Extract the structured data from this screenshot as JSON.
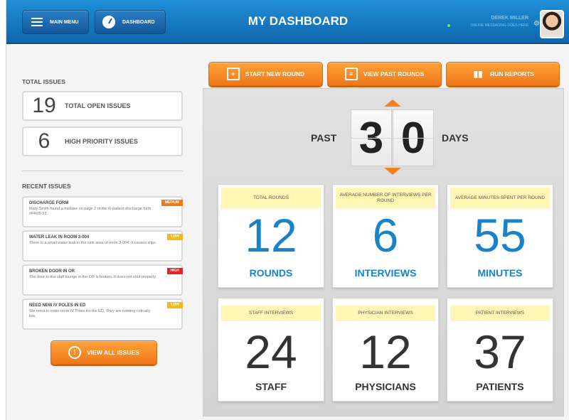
{
  "header": {
    "main_menu_label": "MAIN MENU",
    "dashboard_label": "DASHBOARD",
    "title": "MY DASHBOARD",
    "user_name": "DEREK MILLER",
    "user_status": "ONLINE   MESSAGING GOES HERE"
  },
  "sidebar": {
    "total_issues_heading": "TOTAL ISSUES",
    "open_issues": {
      "count": "19",
      "label": "TOTAL OPEN ISSUES"
    },
    "high_priority": {
      "count": "6",
      "label": "HIGH PRIORITY ISSUES"
    },
    "recent_heading": "RECENT ISSUES",
    "recent_issues": [
      {
        "title": "DISCHARGE FORM",
        "desc": "Mary Smith found a mistake on page 2 of the in-patient discharge form #FR05-22.",
        "priority": "MEDIUM",
        "color": "#f07a1a"
      },
      {
        "title": "WATER LEAK IN ROOM 3-004",
        "desc": "There is a small water leak in the sink area of room 3-004. It causes slips.",
        "priority": "LOW",
        "color": "#f5b81a"
      },
      {
        "title": "BROKEN DOOR IN OR",
        "desc": "The door to the staff lounge in the OR is broken. It does not shut properly.",
        "priority": "HIGH",
        "color": "#e52424"
      },
      {
        "title": "NEED NEW IV POLES IN ED",
        "desc": "We need to order more IV Poles for the ED. They are running critically low.",
        "priority": "LOW",
        "color": "#f5b81a"
      }
    ],
    "view_all_label": "VIEW ALL ISSUES"
  },
  "actions": {
    "start_new_round": "START NEW ROUND",
    "view_past_rounds": "VIEW PAST ROUNDS",
    "run_reports": "RUN REPORTS"
  },
  "period": {
    "prefix": "PAST",
    "digit1": "3",
    "digit2": "0",
    "suffix": "DAYS"
  },
  "stats_row1": [
    {
      "tag": "TOTAL ROUNDS",
      "value": "12",
      "unit": "ROUNDS"
    },
    {
      "tag": "AVERAGE NUMBER OF INTERVIEWS PER ROUND",
      "value": "6",
      "unit": "INTERVIEWS"
    },
    {
      "tag": "AVERAGE MINUTES SPENT PER ROUND",
      "value": "55",
      "unit": "MINUTES"
    }
  ],
  "stats_row2": [
    {
      "tag": "STAFF INTERVIEWS",
      "value": "24",
      "unit": "STAFF"
    },
    {
      "tag": "PHYSICIAN INTERVIEWS",
      "value": "12",
      "unit": "PHYSICIANS"
    },
    {
      "tag": "PATIENT INTERVIEWS",
      "value": "37",
      "unit": "PATIENTS"
    }
  ],
  "colors": {
    "header_blue": "#1277c2",
    "accent_orange": "#f07a1a",
    "stat_blue": "#1a82c8",
    "tag_yellow": "#fff7b3"
  }
}
